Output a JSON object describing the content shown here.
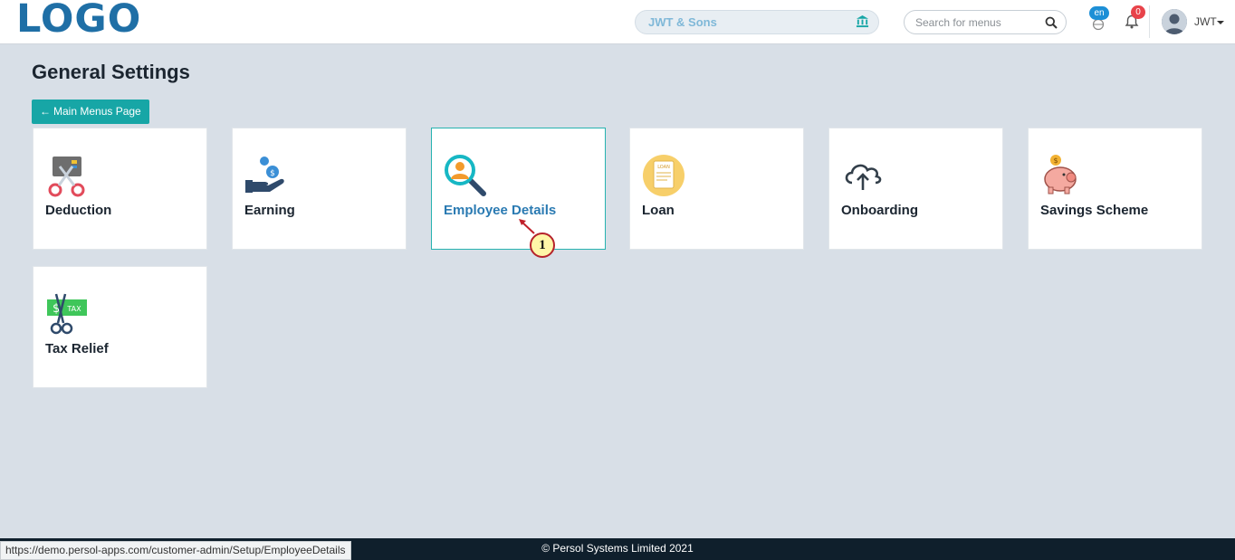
{
  "header": {
    "logo_text": "LOGO",
    "company_name": "JWT & Sons",
    "search_placeholder": "Search for menus",
    "language_badge": "en",
    "notification_count": "0",
    "user_name": "JWT"
  },
  "page": {
    "title": "General Settings",
    "back_button_label": "Main Menus Page"
  },
  "cards": [
    {
      "label": "Deduction",
      "icon": "scissors-card-icon"
    },
    {
      "label": "Earning",
      "icon": "hand-coins-icon"
    },
    {
      "label": "Employee Details",
      "icon": "magnifier-person-icon"
    },
    {
      "label": "Loan",
      "icon": "loan-document-icon"
    },
    {
      "label": "Onboarding",
      "icon": "cloud-upload-icon"
    },
    {
      "label": "Savings Scheme",
      "icon": "piggy-bank-icon"
    },
    {
      "label": "Tax Relief",
      "icon": "tax-scissors-icon"
    }
  ],
  "annotation": {
    "marker_number": "1"
  },
  "footer": {
    "copyright": "© Persol Systems Limited 2021"
  },
  "statusbar": {
    "url": "https://demo.persol-apps.com/customer-admin/Setup/EmployeeDetails"
  },
  "colors": {
    "accent": "#17a6a6",
    "header_bg": "#ffffff",
    "page_bg": "#d8dfe7",
    "footer_bg": "#0f1f2c",
    "active_label": "#2a7ab2"
  }
}
